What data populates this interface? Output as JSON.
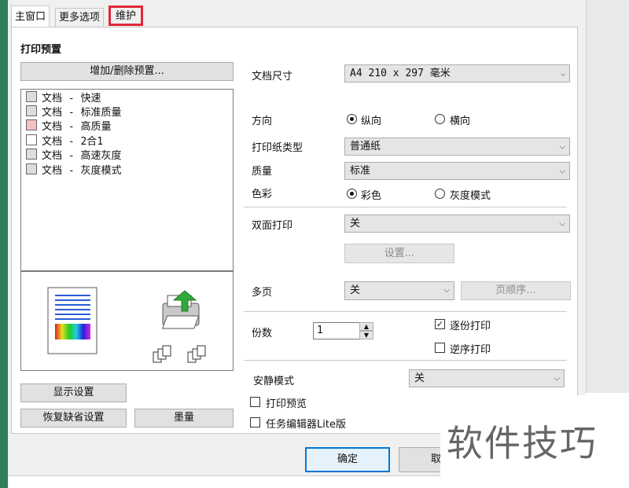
{
  "tabs": [
    {
      "label": "主窗口",
      "active": true
    },
    {
      "label": "更多选项",
      "active": false
    },
    {
      "label": "维护",
      "active": false,
      "highlighted": true
    }
  ],
  "presets": {
    "title": "打印预置",
    "add_remove_button": "增加/删除预置...",
    "items": [
      {
        "icon": "document-fast-icon",
        "label": "文档 - 快速"
      },
      {
        "icon": "document-standard-icon",
        "label": "文档 - 标准质量"
      },
      {
        "icon": "document-high-quality-icon",
        "label": "文档 - 高质量"
      },
      {
        "icon": "two-up-icon",
        "label": "文档 - 2合1"
      },
      {
        "icon": "document-gray-fast-icon",
        "label": "文档 - 高速灰度"
      },
      {
        "icon": "document-grayscale-icon",
        "label": "文档 - 灰度模式"
      }
    ]
  },
  "left_buttons": {
    "show_settings": "显示设置",
    "restore_defaults": "恢复缺省设置",
    "ink_levels": "墨量"
  },
  "settings": {
    "doc_size": {
      "label": "文档尺寸",
      "value": "A4 210 x 297 毫米"
    },
    "orientation": {
      "label": "方向",
      "options": [
        "纵向",
        "横向"
      ],
      "selected": "纵向"
    },
    "paper_type": {
      "label": "打印纸类型",
      "value": "普通纸"
    },
    "quality": {
      "label": "质量",
      "value": "标准"
    },
    "color": {
      "label": "色彩",
      "options": [
        "彩色",
        "灰度模式"
      ],
      "selected": "彩色"
    },
    "duplex": {
      "label": "双面打印",
      "value": "关",
      "settings_button": "设置..."
    },
    "multi_page": {
      "label": "多页",
      "value": "关",
      "page_order_button": "页顺序..."
    },
    "copies": {
      "label": "份数",
      "value": "1",
      "collate": {
        "label": "逐份打印",
        "checked": true
      },
      "reverse": {
        "label": "逆序打印",
        "checked": false
      }
    },
    "quiet_mode": {
      "label": "安静模式",
      "value": "关"
    },
    "print_preview": {
      "label": "打印预览",
      "checked": false
    },
    "job_arranger": {
      "label": "任务编辑器Lite版",
      "checked": false
    }
  },
  "footer": {
    "ok_button": "确定",
    "cancel_button_partial": "取"
  },
  "watermark": "软件技巧",
  "colors": {
    "highlight": "#e0283a",
    "accent": "#0078d7"
  }
}
